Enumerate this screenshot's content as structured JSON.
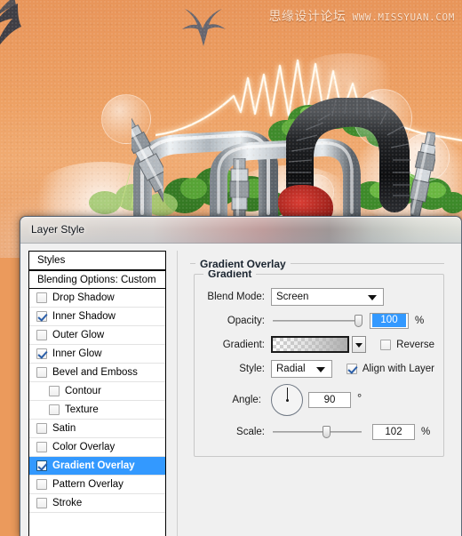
{
  "artwork": {
    "watermark_cn": "思缘设计论坛",
    "watermark_url": "WWW.MISSYUAN.COM",
    "background_color": "#eb9a5c",
    "elements": [
      "bird-silhouette",
      "glow-waveform",
      "bubble",
      "chrome-pipe",
      "spark-plug",
      "corrugated-hose",
      "foliage",
      "mist"
    ]
  },
  "dialog": {
    "title": "Layer Style",
    "styles_list": {
      "header_items": [
        {
          "label": "Styles"
        },
        {
          "label": "Blending Options: Custom"
        }
      ],
      "effects": [
        {
          "label": "Drop Shadow",
          "checked": false,
          "indent": false,
          "selected": false
        },
        {
          "label": "Inner Shadow",
          "checked": true,
          "indent": false,
          "selected": false
        },
        {
          "label": "Outer Glow",
          "checked": false,
          "indent": false,
          "selected": false
        },
        {
          "label": "Inner Glow",
          "checked": true,
          "indent": false,
          "selected": false
        },
        {
          "label": "Bevel and Emboss",
          "checked": false,
          "indent": false,
          "selected": false
        },
        {
          "label": "Contour",
          "checked": false,
          "indent": true,
          "selected": false
        },
        {
          "label": "Texture",
          "checked": false,
          "indent": true,
          "selected": false
        },
        {
          "label": "Satin",
          "checked": false,
          "indent": false,
          "selected": false
        },
        {
          "label": "Color Overlay",
          "checked": false,
          "indent": false,
          "selected": false
        },
        {
          "label": "Gradient Overlay",
          "checked": true,
          "indent": false,
          "selected": true
        },
        {
          "label": "Pattern Overlay",
          "checked": false,
          "indent": false,
          "selected": false
        },
        {
          "label": "Stroke",
          "checked": false,
          "indent": false,
          "selected": false
        }
      ],
      "selection_color": "#3399ff"
    },
    "panel": {
      "section_title": "Gradient Overlay",
      "group_legend": "Gradient",
      "blend_mode": {
        "label": "Blend Mode:",
        "value": "Screen"
      },
      "opacity": {
        "label": "Opacity:",
        "value": "100",
        "unit": "%"
      },
      "gradient": {
        "label": "Gradient:",
        "reverse_label": "Reverse",
        "reverse_checked": false
      },
      "style": {
        "label": "Style:",
        "value": "Radial",
        "align_label": "Align with Layer",
        "align_checked": true
      },
      "angle": {
        "label": "Angle:",
        "value": "90",
        "unit": "°"
      },
      "scale": {
        "label": "Scale:",
        "value": "102",
        "unit": "%"
      }
    }
  }
}
